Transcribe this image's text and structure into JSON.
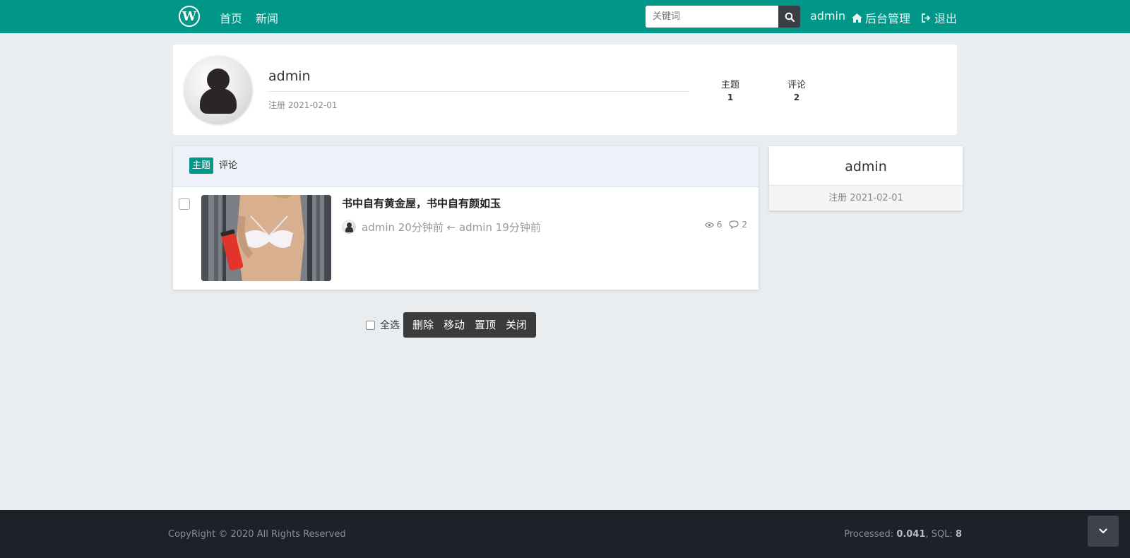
{
  "header": {
    "logo_letter": "W",
    "nav": [
      {
        "label": "首页"
      },
      {
        "label": "新闻"
      }
    ],
    "search_placeholder": "关键词",
    "user": "admin",
    "admin_label": "后台管理",
    "logout_label": "退出",
    "brand_color": "#009688"
  },
  "profile": {
    "name": "admin",
    "registered": "注册 2021-02-01",
    "stats": [
      {
        "label": "主题",
        "value": "1"
      },
      {
        "label": "评论",
        "value": "2"
      }
    ]
  },
  "tabs": [
    {
      "label": "主题",
      "active": true
    },
    {
      "label": "评论",
      "active": false
    }
  ],
  "posts": [
    {
      "title": "书中自有黄金屋，书中自有颜如玉",
      "meta": "admin 20分钟前 ← admin 19分钟前",
      "views": "6",
      "comments": "2"
    }
  ],
  "batch": {
    "select_all": "全选",
    "buttons": [
      "删除",
      "移动",
      "置顶",
      "关闭"
    ]
  },
  "sidebar": {
    "name": "admin",
    "registered": "注册 2021-02-01"
  },
  "footer": {
    "copyright": "CopyRight © 2020 All Rights Reserved",
    "processed_label": "Processed: ",
    "processed_value": "0.041",
    "sql_label": ", SQL: ",
    "sql_value": "8"
  }
}
